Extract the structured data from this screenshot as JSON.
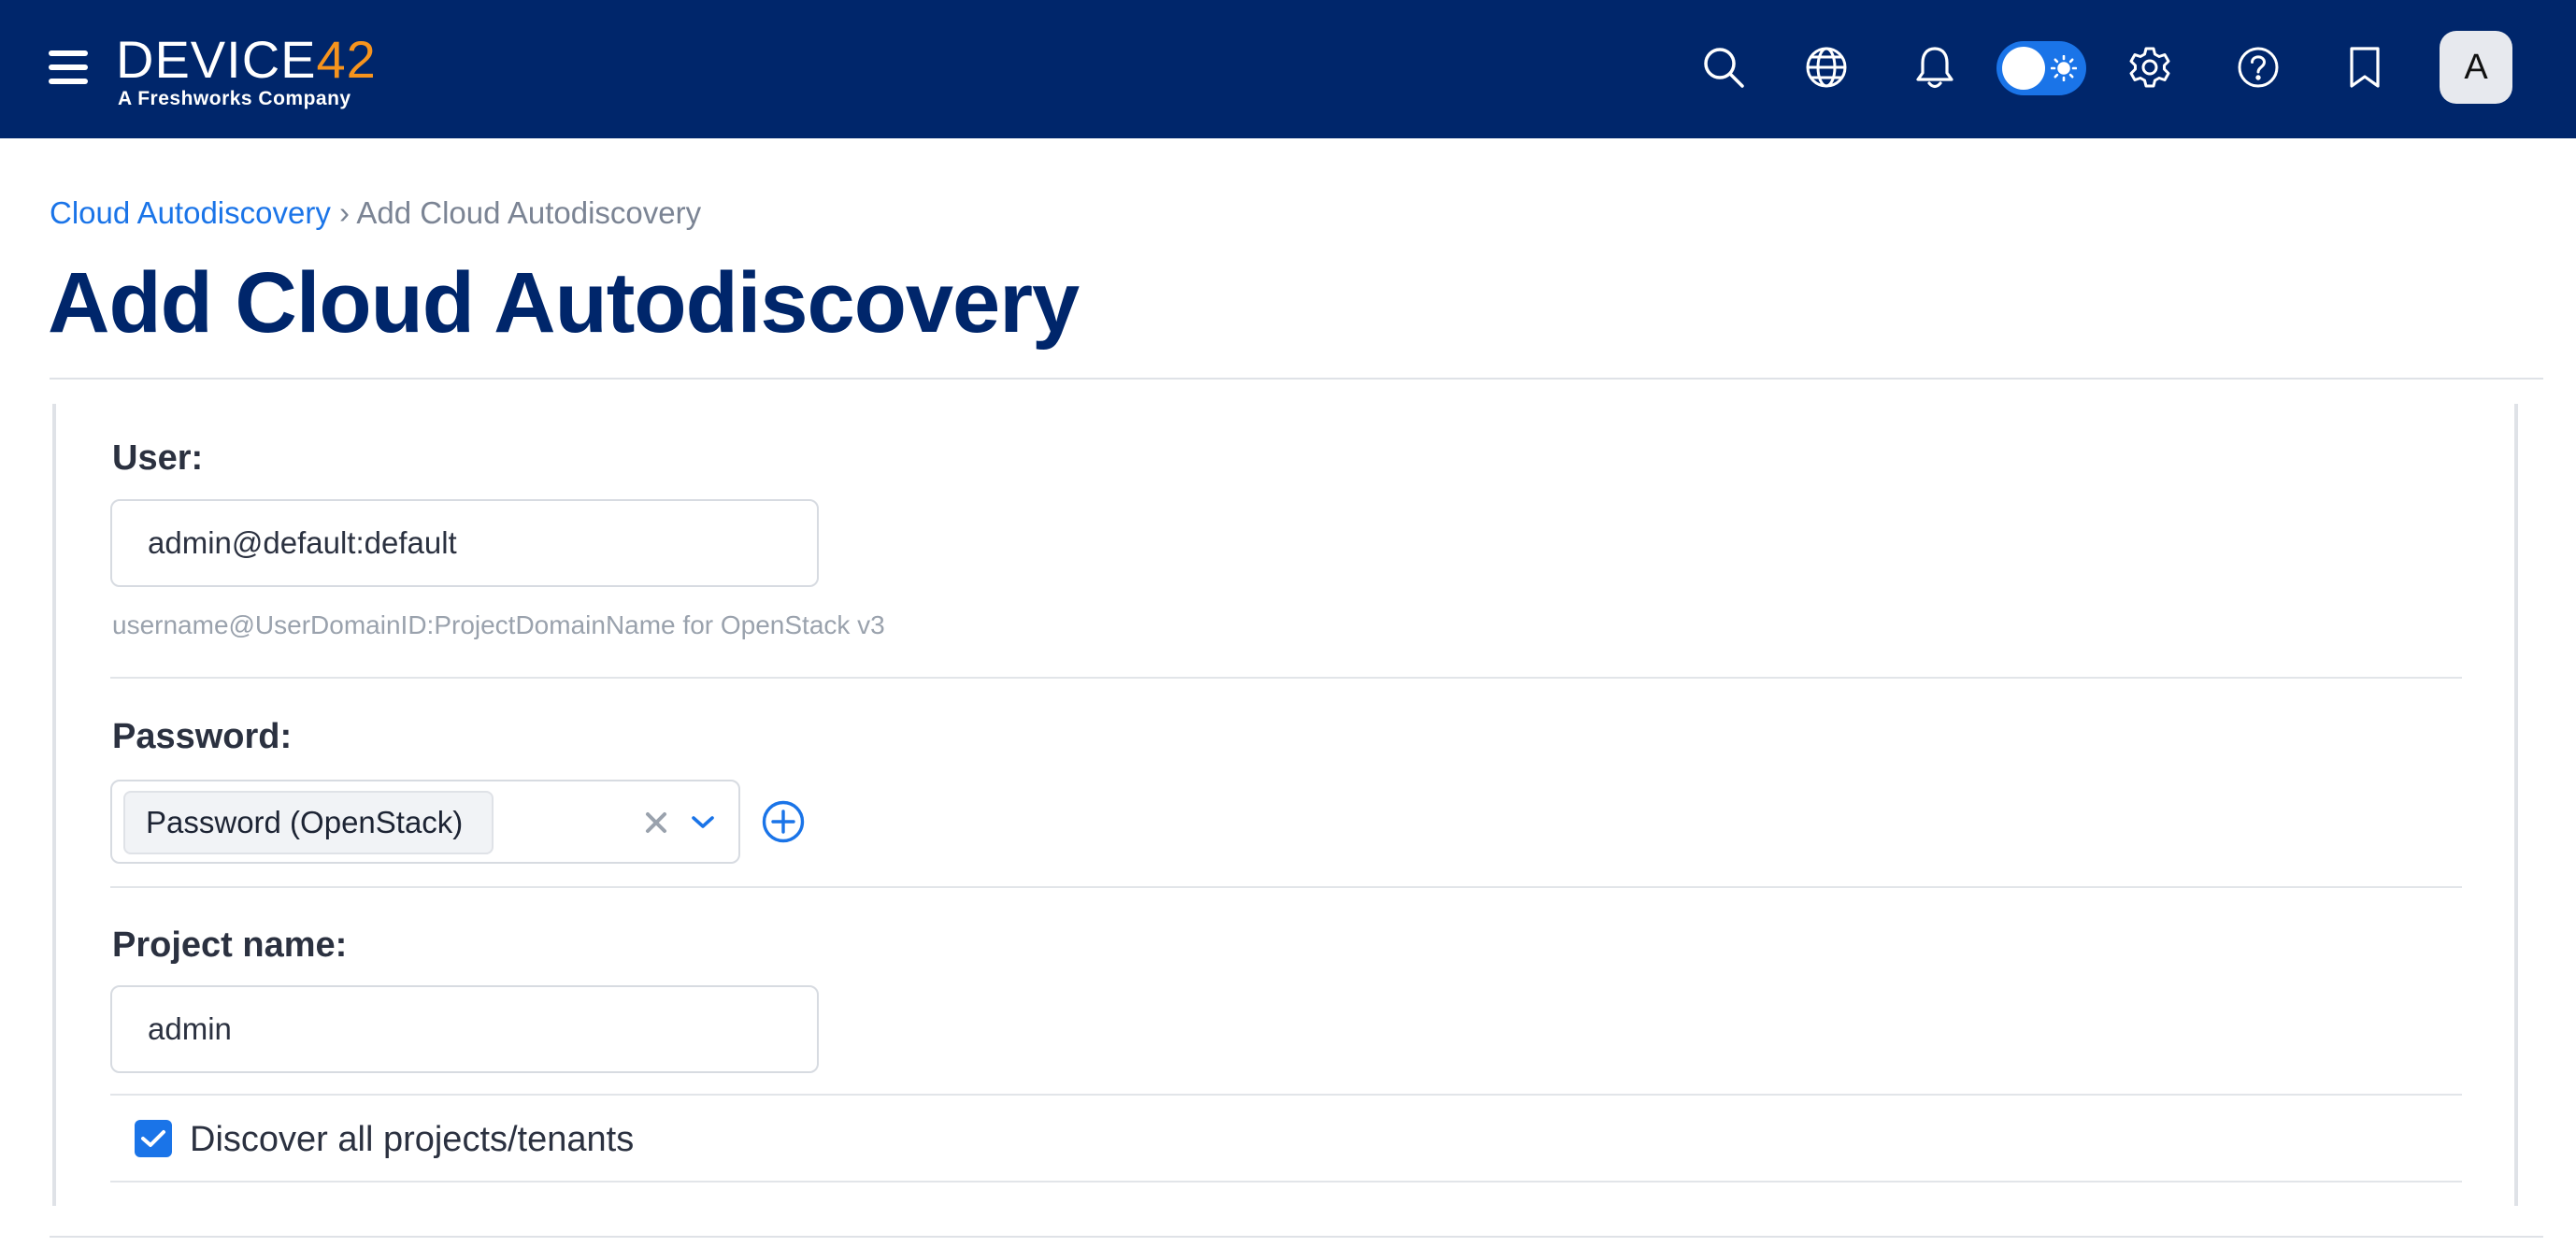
{
  "header": {
    "logo_main": "DEVICE",
    "logo_accent": "42",
    "logo_tagline": "A Freshworks Company",
    "avatar_initial": "A"
  },
  "breadcrumb": {
    "parent": "Cloud Autodiscovery",
    "separator": "›",
    "current": "Add Cloud Autodiscovery"
  },
  "page": {
    "title": "Add Cloud Autodiscovery"
  },
  "form": {
    "user": {
      "label": "User:",
      "value": "admin@default:default",
      "help": "username@UserDomainID:ProjectDomainName for OpenStack v3"
    },
    "password": {
      "label": "Password:",
      "selected": "Password (OpenStack)"
    },
    "project": {
      "label": "Project name:",
      "value": "admin"
    },
    "discover_all": {
      "label": "Discover all projects/tenants",
      "checked": true
    }
  },
  "colors": {
    "navbar": "#00266b",
    "accent": "#1a74e8",
    "logo_accent": "#f7941d",
    "title": "#00266b"
  },
  "icons": [
    "menu-icon",
    "search-icon",
    "globe-icon",
    "bell-icon",
    "theme-toggle",
    "gear-icon",
    "help-icon",
    "bookmark-icon",
    "close-icon",
    "chevron-down-icon",
    "plus-circle-icon",
    "check-icon"
  ]
}
